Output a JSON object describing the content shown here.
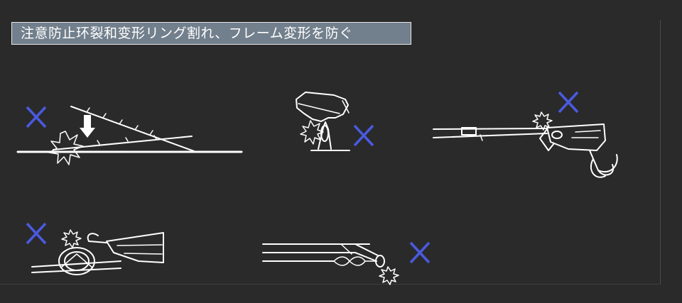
{
  "title": "注意防止环裂和变形リング割れ、フレーム変形を防ぐ",
  "colors": {
    "background": "#2a2a2a",
    "title_bar": "#727f8c",
    "line_art": "#ffffff",
    "wrong_mark": "#4a5ae0"
  },
  "panels": [
    {
      "id": "rod-on-ground",
      "mark": "x-mark-icon"
    },
    {
      "id": "step-on-guide",
      "mark": "x-mark-icon"
    },
    {
      "id": "lure-hits-tip",
      "mark": "x-mark-icon"
    },
    {
      "id": "hook-on-guide",
      "mark": "x-mark-icon"
    },
    {
      "id": "swivel-in-guide",
      "mark": "x-mark-icon"
    }
  ]
}
